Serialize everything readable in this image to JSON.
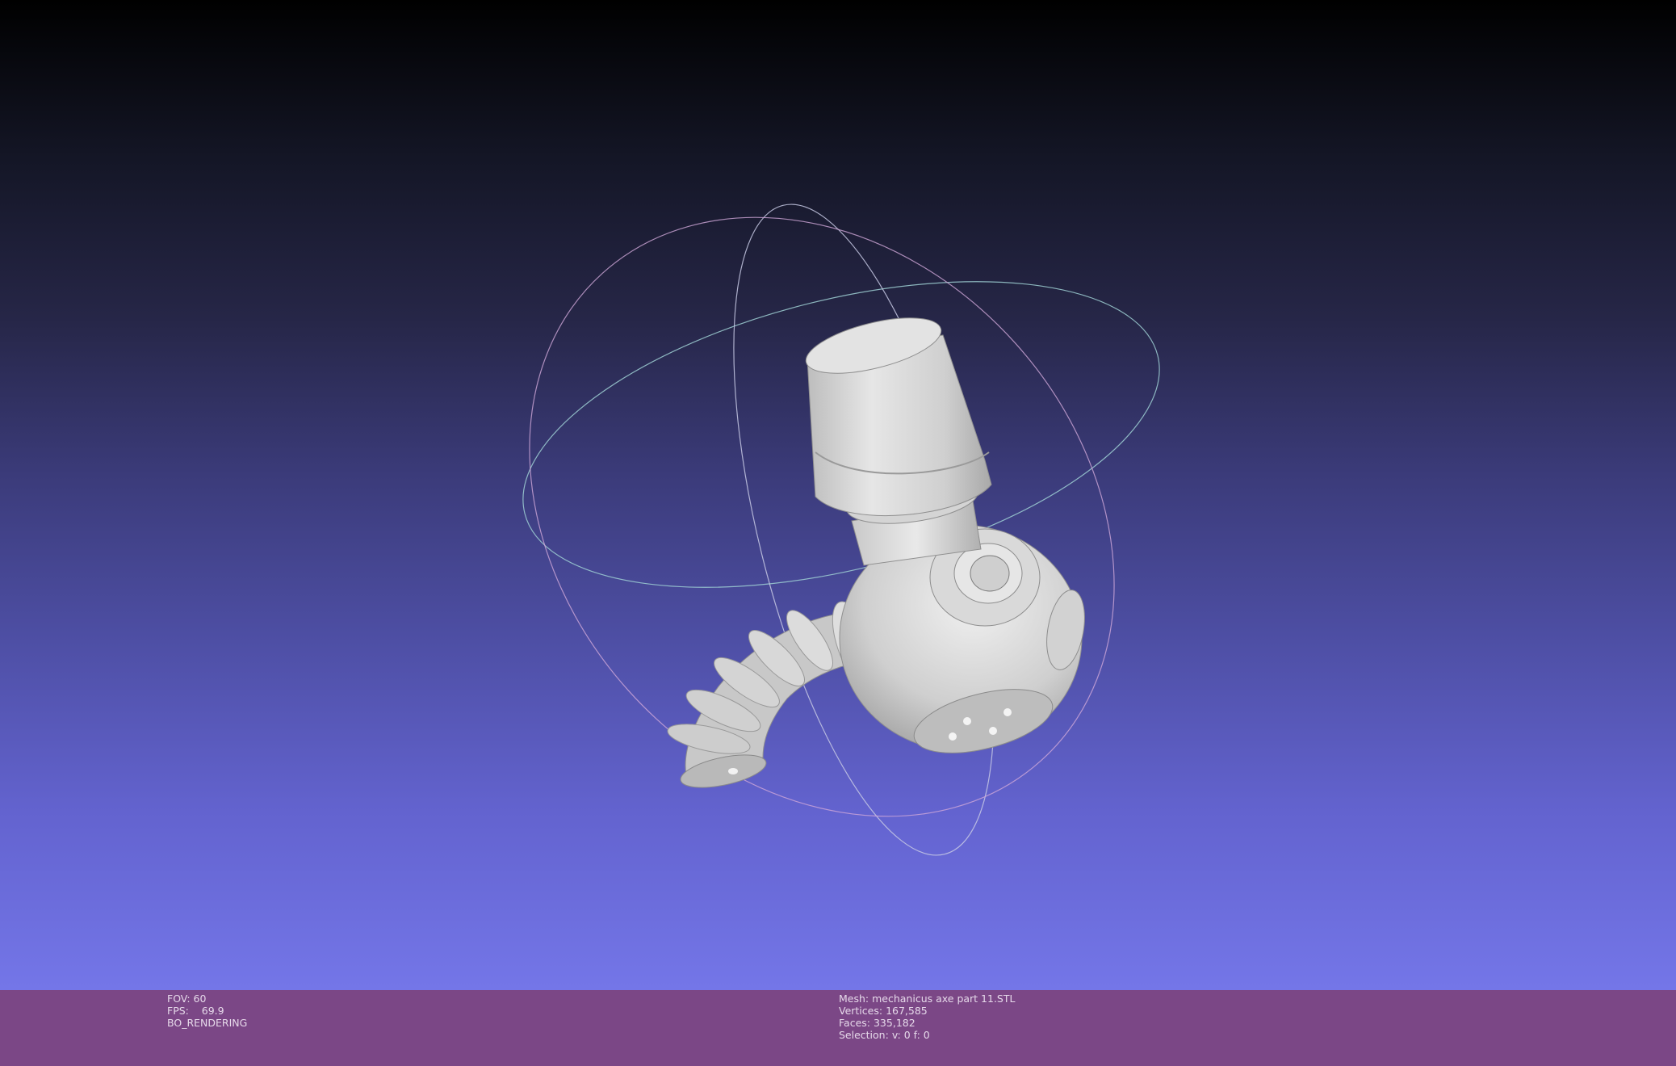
{
  "viewer": {
    "background_top": "#000000",
    "background_bottom": "#7476e8",
    "model_color": "#d7d7d7",
    "trackball_colors": [
      "#c7c9e4",
      "#cfa7d8",
      "#9fd0d4"
    ]
  },
  "status": {
    "fov_label": "FOV:",
    "fov_value": "60",
    "fps_label": "FPS:",
    "fps_value": "69.9",
    "render_mode": "BO_RENDERING",
    "mesh_label": "Mesh:",
    "mesh_name": "mechanicus axe part 11.STL",
    "vertices_label": "Vertices:",
    "vertices_value": "167,585",
    "faces_label": "Faces:",
    "faces_value": "335,182",
    "selection_label": "Selection:",
    "selection_value": "v: 0 f: 0",
    "bar_color": "#7b4786"
  }
}
